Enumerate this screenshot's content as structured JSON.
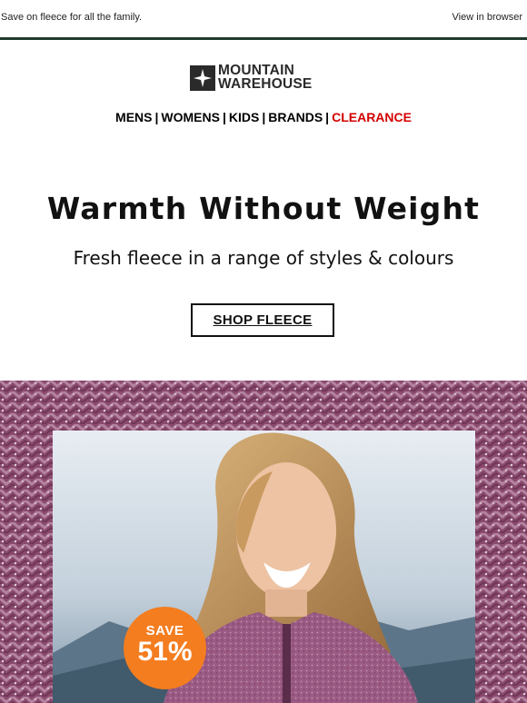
{
  "preheader": {
    "text": "Save on fleece for all the family.",
    "view_in_browser": "View in browser"
  },
  "logo": {
    "line1": "MOUNTAIN",
    "line2": "WAREHOUSE"
  },
  "nav": {
    "items": [
      {
        "label": "MENS"
      },
      {
        "label": "WOMENS"
      },
      {
        "label": "KIDS"
      },
      {
        "label": "BRANDS"
      },
      {
        "label": "CLEARANCE"
      }
    ],
    "separator": "|"
  },
  "promo": {
    "headline": "Warmth Without Weight",
    "subhead": "Fresh fleece in a range of styles & colours",
    "cta_label": "SHOP FLEECE"
  },
  "badge": {
    "line1": "SAVE",
    "line2": "51%"
  },
  "colors": {
    "rule": "#1f3a2d",
    "clearance": "#d40000",
    "badge": "#f47d20",
    "fleece": "#8a4a6e"
  },
  "icons": {
    "logo_mark": "compass-star-icon"
  }
}
